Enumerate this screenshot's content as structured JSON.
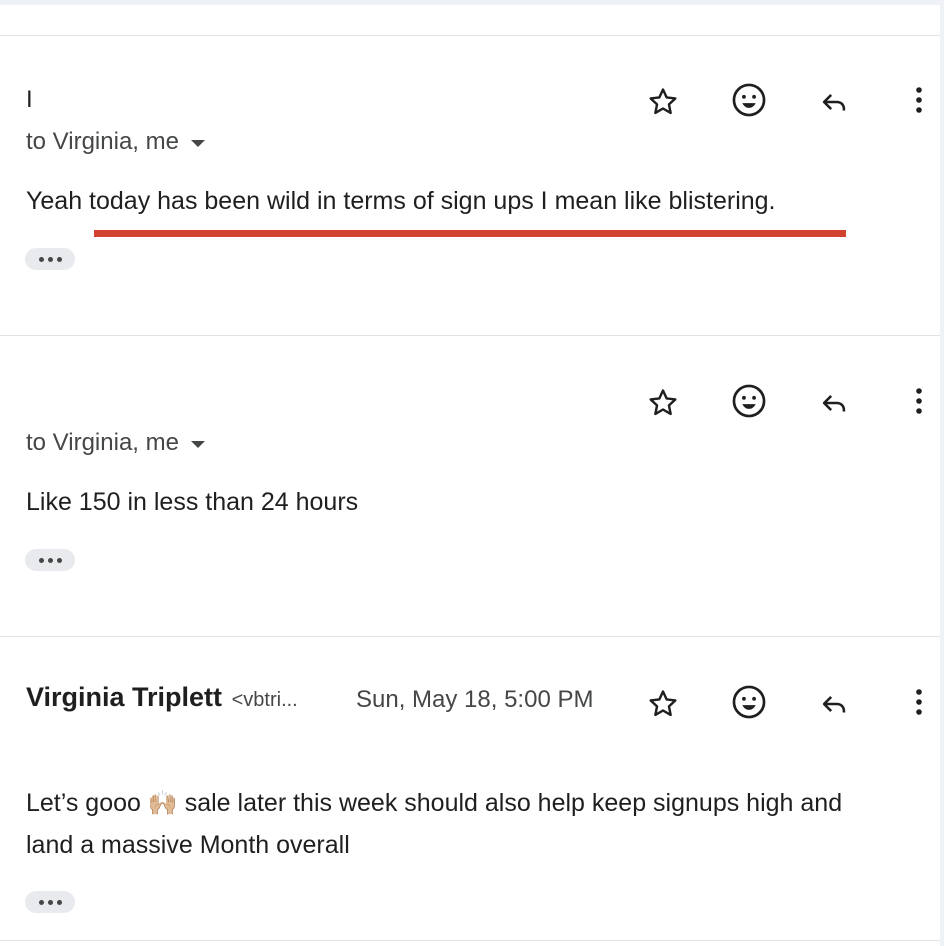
{
  "messages": [
    {
      "sender_initial": "I",
      "recipients": "to Virginia, me",
      "body": "Yeah today has been wild in terms of sign ups I mean like blistering."
    },
    {
      "recipients": "to Virginia, me",
      "body": "Like 150 in less than 24 hours"
    },
    {
      "sender_name": "Virginia Triplett",
      "sender_email": "<vbtri...",
      "date": "Sun, May 18, 5:00 PM",
      "body_line1_a": "Let’s gooo",
      "emoji": "🙌🏼",
      "body_line1_b": "sale later this week should also help keep signups high and",
      "body_line2": "land a massive Month overall"
    }
  ],
  "icons": {
    "star": "star-icon",
    "emoji": "add-reaction-icon",
    "reply": "reply-icon",
    "more": "more-vert-icon"
  },
  "colors": {
    "highlight_underline": "#d2432f",
    "secondary_text": "#444746"
  }
}
